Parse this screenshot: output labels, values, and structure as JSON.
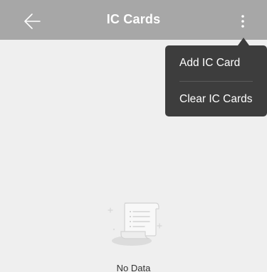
{
  "header": {
    "title": "IC Cards",
    "back_icon": "back-arrow-icon",
    "more_icon": "more-vertical-icon",
    "background_color": "#a7a7a7"
  },
  "menu": {
    "items": [
      {
        "label": "Add IC Card"
      },
      {
        "label": "Clear IC Cards"
      }
    ],
    "background_color": "#3d3d3d"
  },
  "empty_state": {
    "icon": "empty-document-icon",
    "text": "No Data"
  },
  "page": {
    "background_color": "#efefef"
  }
}
